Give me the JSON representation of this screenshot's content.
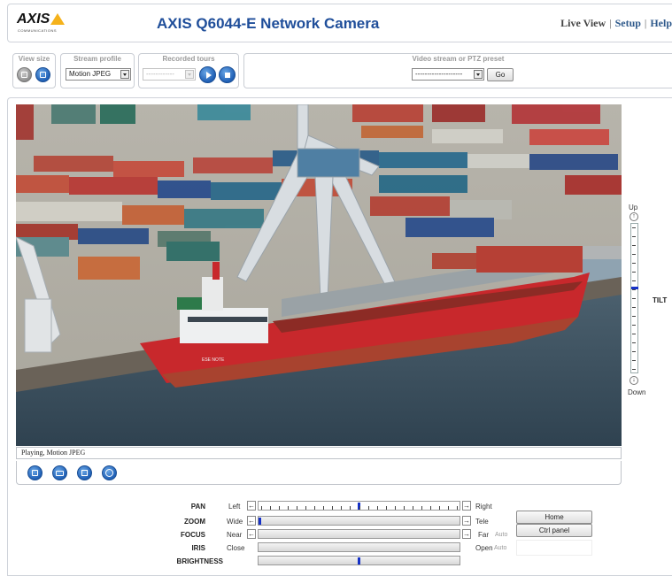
{
  "header": {
    "logo_text": "AXIS",
    "logo_sub": "COMMUNICATIONS",
    "title": "AXIS Q6044-E Network Camera",
    "nav": {
      "live_view": "Live View",
      "setup": "Setup",
      "help": "Help",
      "separator": "|"
    }
  },
  "toolbar": {
    "view_size_label": "View size",
    "stream_profile_label": "Stream profile",
    "stream_profile_value": "Motion JPEG",
    "recorded_tours_label": "Recorded tours",
    "recorded_tours_value": "------------",
    "preset_label": "Video stream or PTZ preset",
    "preset_value": "--------------------",
    "go_label": "Go"
  },
  "status": {
    "text": "Playing, Motion JPEG"
  },
  "tilt": {
    "label": "TILT",
    "up": "Up",
    "down": "Down",
    "level": 0.42
  },
  "controls": {
    "pan": {
      "label": "PAN",
      "min": "Left",
      "max": "Right",
      "level": 0.5
    },
    "zoom": {
      "label": "ZOOM",
      "min": "Wide",
      "max": "Tele",
      "level": 0.0
    },
    "focus": {
      "label": "FOCUS",
      "min": "Near",
      "max": "Far",
      "auto": "Auto"
    },
    "iris": {
      "label": "IRIS",
      "min": "Close",
      "max": "Open",
      "auto": "Auto"
    },
    "brightness": {
      "label": "BRIGHTNESS",
      "level": 0.5
    }
  },
  "buttons": {
    "home": "Home",
    "ctrl_panel": "Ctrl panel"
  },
  "colors": {
    "title_blue": "#1f4e9a",
    "thumb_blue": "#1531c8",
    "logo_yellow": "#f5b21b",
    "hull_red": "#c8282c"
  }
}
